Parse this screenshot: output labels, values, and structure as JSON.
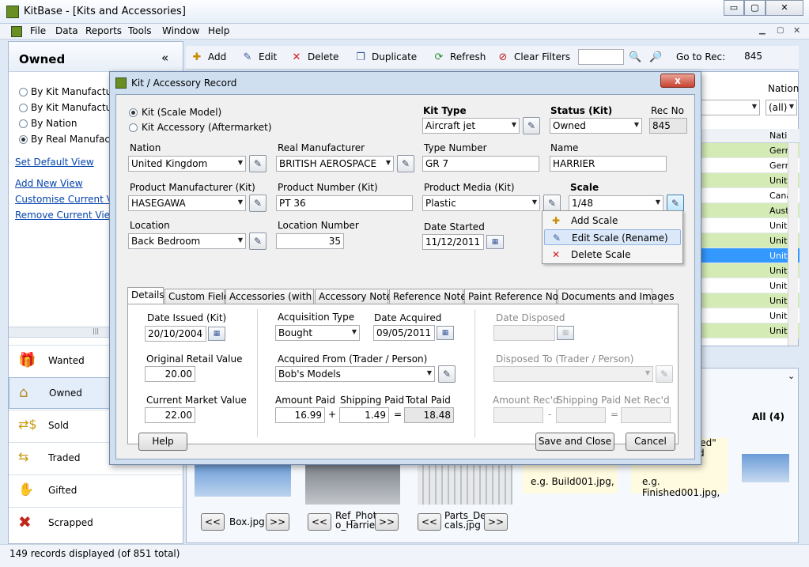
{
  "window": {
    "title": "KitBase - [Kits and Accessories]",
    "min": "▭",
    "restore": "▢",
    "close": "✕"
  },
  "menu": [
    "File",
    "Data",
    "Reports",
    "Tools",
    "Window",
    "Help"
  ],
  "left": {
    "header": "Owned",
    "collapse": "«",
    "views": [
      "By Kit Manufacturer",
      "By Kit Manufacturer",
      "By Nation",
      "By Real Manufacturer"
    ],
    "links": [
      "Set Default View",
      "Add New View",
      "Customise Current View",
      "Remove Current View"
    ],
    "scroll": "|||",
    "nav": [
      "Wanted",
      "Owned",
      "Sold",
      "Traded",
      "Gifted",
      "Scrapped"
    ]
  },
  "toolbar": {
    "add": "Add",
    "edit": "Edit",
    "delete": "Delete",
    "duplicate": "Duplicate",
    "refresh": "Refresh",
    "clear": "Clear Filters",
    "goto": "Go to Rec:",
    "goto_value": "845"
  },
  "grid": {
    "nation_header": "Nation",
    "nation_filter": "(all)",
    "col": "Nati",
    "rows": [
      "Gern",
      "Gern",
      "Unite",
      "Cana",
      "Aust",
      "Unite",
      "Unite",
      "Unite",
      "Unite",
      "Unite",
      "Unite",
      "Unite",
      "Unite"
    ],
    "row_colors": [
      "#d5ebb5",
      "#ffffff",
      "#d5ebb5",
      "#ffffff",
      "#d5ebb5",
      "#ffffff",
      "#d5ebb5",
      "#3399ff",
      "#d5ebb5",
      "#ffffff",
      "#d5ebb5",
      "#ffffff",
      "#d5ebb5"
    ]
  },
  "photos": {
    "all": "All (4)",
    "captions": [
      "Box.jpg",
      "Ref_Phot o_Harrier",
      "Parts_De cals.jpg"
    ],
    "prev": "<<",
    "next": ">>",
    "hint1": "e.g. Build001.jpg,",
    "hint2": "e.g. Finished001.jpg,",
    "hint_top": "ished\" and"
  },
  "status": "149 records displayed (of 851 total)",
  "dialog": {
    "title": "Kit / Accessory Record",
    "close": "x",
    "radio_kit": "Kit (Scale Model)",
    "radio_acc": "Kit Accessory (Aftermarket)",
    "kit_type_label": "Kit Type",
    "kit_type": "Aircraft jet",
    "status_label": "Status (Kit)",
    "status": "Owned",
    "recno_label": "Rec No",
    "recno": "845",
    "nation_label": "Nation",
    "nation": "United Kingdom",
    "realman_label": "Real Manufacturer",
    "realman": "BRITISH AEROSPACE",
    "typenum_label": "Type Number",
    "typenum": "GR 7",
    "name_label": "Name",
    "name": "HARRIER",
    "prodman_label": "Product Manufacturer (Kit)",
    "prodman": "HASEGAWA",
    "prodnum_label": "Product Number (Kit)",
    "prodnum": "PT 36",
    "media_label": "Product Media (Kit)",
    "media": "Plastic",
    "scale_label": "Scale",
    "scale": "1/48",
    "location_label": "Location",
    "location": "Back Bedroom",
    "locnum_label": "Location Number",
    "locnum": "35",
    "started_label": "Date Started",
    "started": "11/12/2011",
    "context_menu": [
      "Add Scale",
      "Edit Scale (Rename)",
      "Delete Scale"
    ],
    "tabs": [
      "Details",
      "Custom Fields",
      "Accessories (with Kit)",
      "Accessory Notes",
      "Reference Notes",
      "Paint Reference Notes",
      "Documents and Images"
    ],
    "details": {
      "issued_label": "Date Issued (Kit)",
      "issued": "20/10/2004",
      "retail_label": "Original Retail Value",
      "retail": "20.00",
      "market_label": "Current Market Value",
      "market": "22.00",
      "acqtype_label": "Acquisition Type",
      "acqtype": "Bought",
      "acqdate_label": "Date Acquired",
      "acqdate": "09/05/2011",
      "acqfrom_label": "Acquired From (Trader / Person)",
      "acqfrom": "Bob's Models",
      "amt_label": "Amount Paid",
      "amt": "16.99",
      "ship_label": "Shipping Paid",
      "ship": "1.49",
      "total_label": "Total Paid",
      "total": "18.48",
      "plus": "+",
      "eq": "=",
      "minus": "-",
      "disposed_label": "Date Disposed",
      "disposedto_label": "Disposed To (Trader / Person)",
      "amtrec_label": "Amount Rec'd",
      "shiprec_label": "Shipping Paid",
      "netrec_label": "Net Rec'd"
    },
    "help": "Help",
    "save": "Save and Close",
    "cancel": "Cancel"
  }
}
